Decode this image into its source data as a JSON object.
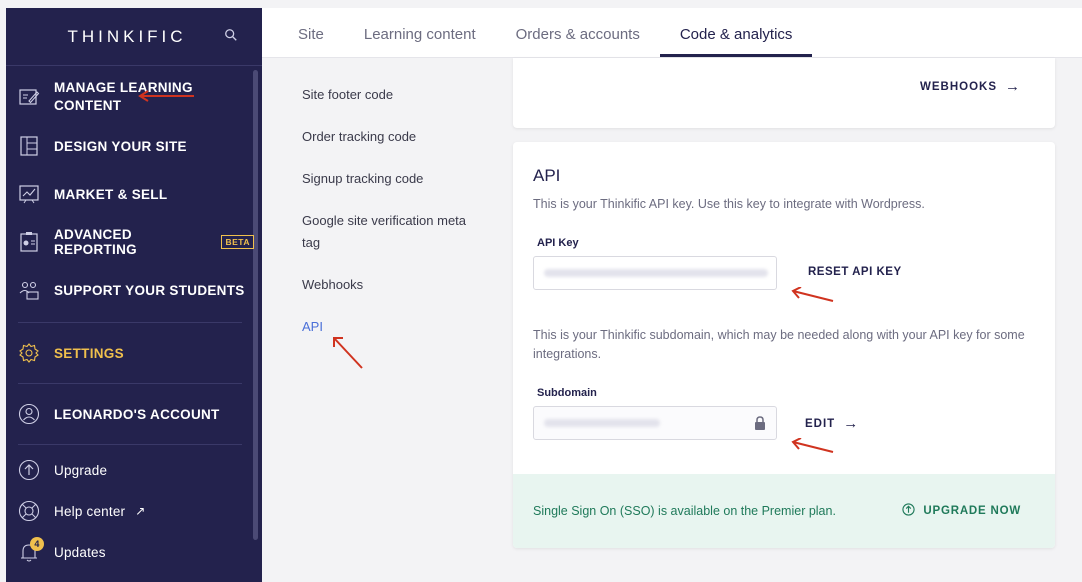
{
  "sidebar": {
    "logo": "THINKIFIC",
    "items": [
      {
        "label": "MANAGE LEARNING CONTENT",
        "icon": "edit-board-icon"
      },
      {
        "label": "DESIGN YOUR SITE",
        "icon": "layout-icon"
      },
      {
        "label": "MARKET & SELL",
        "icon": "chart-board-icon"
      },
      {
        "label": "ADVANCED REPORTING",
        "badge": "BETA",
        "icon": "report-icon"
      },
      {
        "label": "SUPPORT YOUR STUDENTS",
        "icon": "students-icon"
      },
      {
        "label": "SETTINGS",
        "icon": "gear-icon"
      },
      {
        "label": "LEONARDO'S ACCOUNT",
        "icon": "account-icon"
      }
    ],
    "bottom": [
      {
        "label": "Upgrade",
        "icon": "upgrade-icon"
      },
      {
        "label": "Help center",
        "icon": "lifebuoy-icon"
      },
      {
        "label": "Updates",
        "icon": "bell-icon",
        "count": "4"
      }
    ]
  },
  "tabs": [
    "Site",
    "Learning content",
    "Orders & accounts",
    "Code & analytics"
  ],
  "subnav": [
    "Site footer code",
    "Order tracking code",
    "Signup tracking code",
    "Google site verification meta tag",
    "Webhooks",
    "API"
  ],
  "webhooks_link": "WEBHOOKS",
  "api": {
    "title": "API",
    "description": "This is your Thinkific API key. Use this key to integrate with Wordpress.",
    "key_label": "API Key",
    "reset_label": "RESET API KEY",
    "subdomain_desc": "This is your Thinkific subdomain, which may be needed along with your API key for some integrations.",
    "subdomain_label": "Subdomain",
    "edit_label": "EDIT"
  },
  "upgrade": {
    "text": "Single Sign On (SSO) is available on the Premier plan.",
    "button": "UPGRADE NOW"
  },
  "colors": {
    "sidebar_bg": "#23224d",
    "accent_yellow": "#f0c04d",
    "link_blue": "#4a6fd8",
    "annotation_red": "#d0331f",
    "sso_green": "#1f7a5a"
  }
}
